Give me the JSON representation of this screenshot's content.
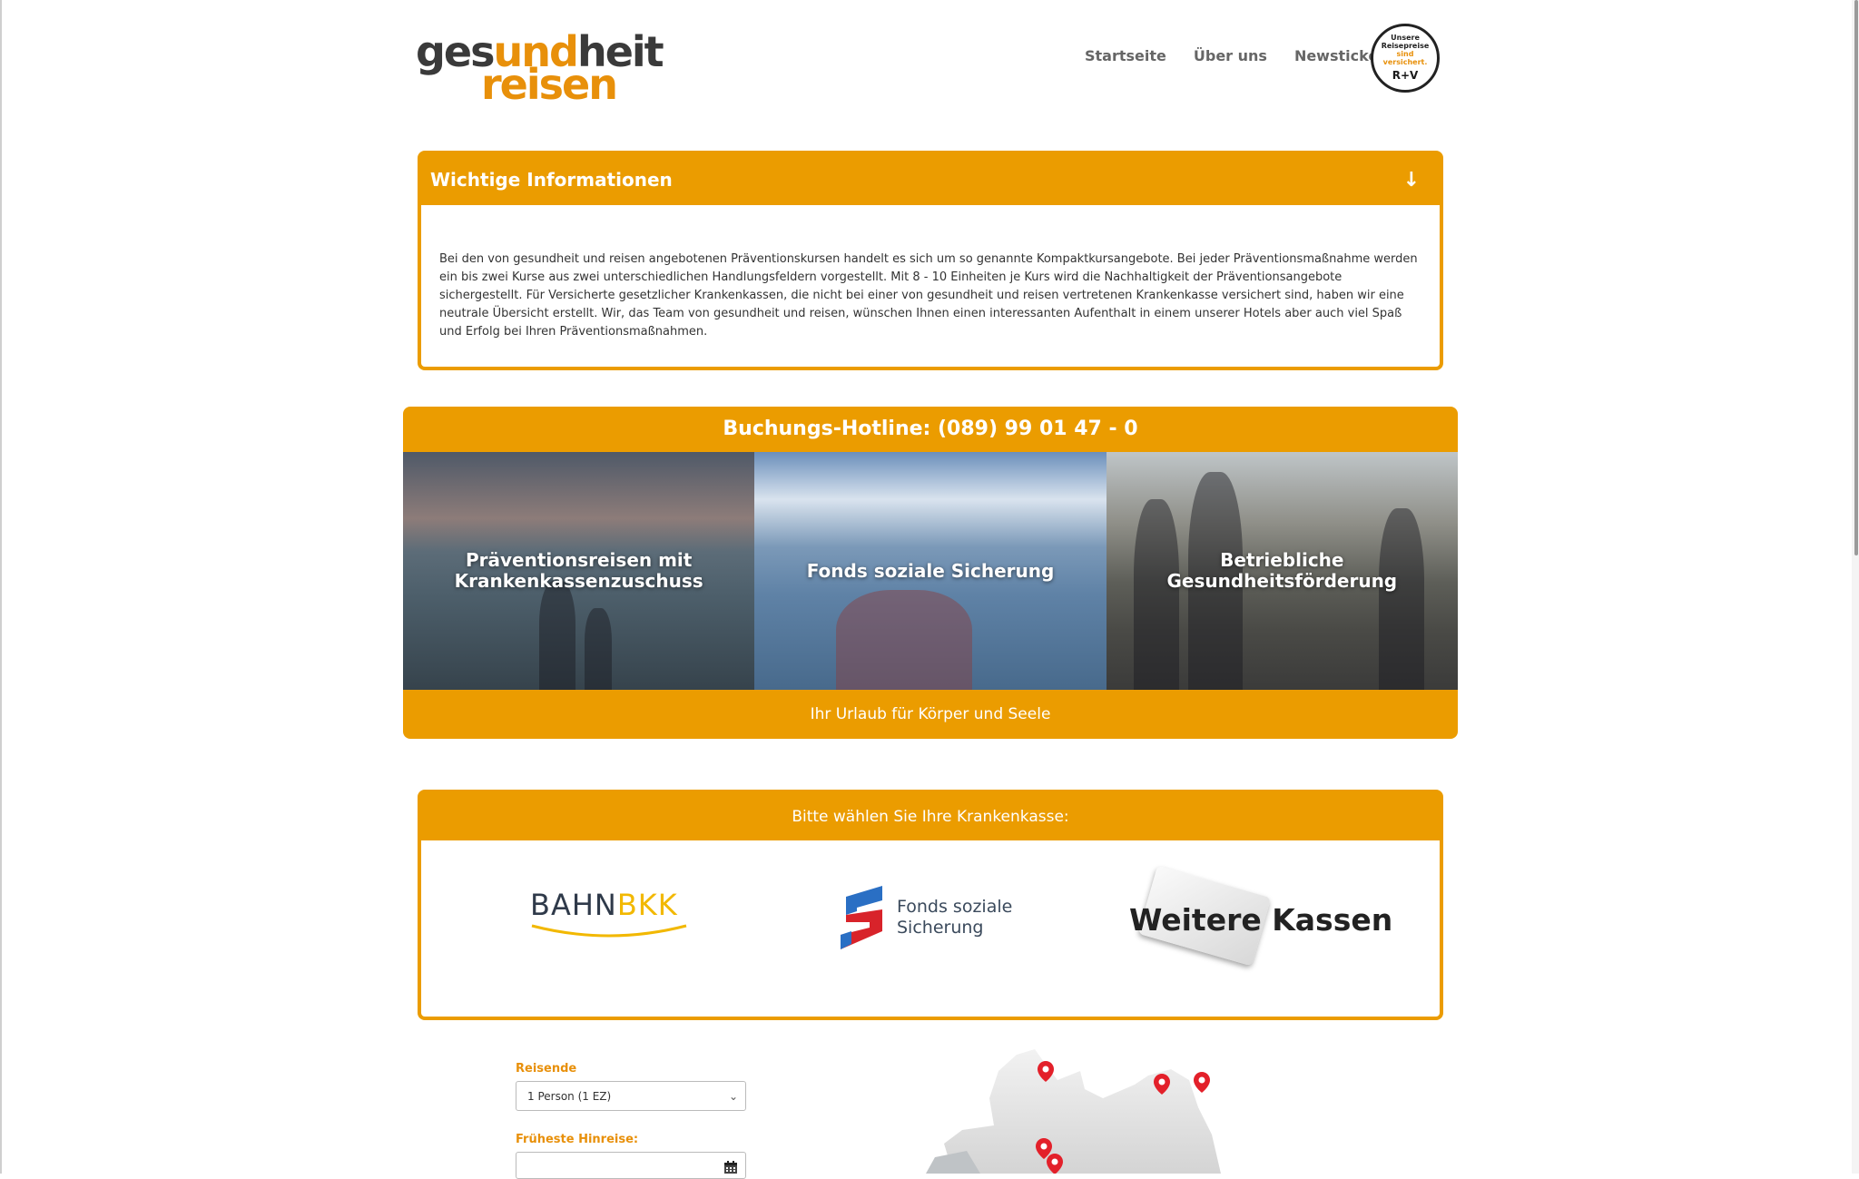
{
  "header": {
    "logo_line1_a": "ges",
    "logo_line1_b": "und",
    "logo_line1_c": "heit",
    "logo_line2": "reisen",
    "nav": [
      "Startseite",
      "Über uns",
      "Newsticker"
    ],
    "seal": {
      "line1": "Unsere",
      "line2": "Reisepreise",
      "line3": "sind versichert.",
      "brand": "R+V"
    }
  },
  "info": {
    "title": "Wichtige Informationen",
    "arrow": "↓",
    "text": "Bei den von gesundheit und reisen angebotenen Präventionskursen handelt es sich um so genannte Kompaktkursangebote. Bei jeder Präventionsmaßnahme werden ein bis zwei Kurse aus zwei unterschiedlichen Handlungsfeldern vorgestellt. Mit 8 - 10 Einheiten je Kurs wird die Nachhaltigkeit der Präventionsangebote sichergestellt. Für Versicherte gesetzlicher Krankenkassen, die nicht bei einer von gesundheit und reisen vertretenen Krankenkasse versichert sind, haben wir eine neutrale Übersicht erstellt. Wir, das Team von gesundheit und reisen, wünschen Ihnen einen interessanten Aufenthalt in einem unserer Hotels aber auch viel Spaß und Erfolg bei Ihren Präventionsmaßnahmen."
  },
  "hotline": {
    "text": "Buchungs-Hotline: (089) 99 01 47 - 0",
    "tiles": [
      {
        "line1": "Präventionsreisen mit",
        "line2": "Krankenkassenzuschuss"
      },
      {
        "line1": "Fonds soziale Sicherung",
        "line2": ""
      },
      {
        "line1": "Betriebliche",
        "line2": "Gesundheitsförderung"
      }
    ],
    "tagline": "Ihr Urlaub für Körper und Seele"
  },
  "kasse": {
    "title": "Bitte wählen Sie Ihre Krankenkasse:",
    "bahn": "BAHN",
    "bkk": "BKK",
    "fonds_line1": "Fonds soziale",
    "fonds_line2": "Sicherung",
    "weitere": "Weitere Kassen"
  },
  "form": {
    "reisende_label": "Reisende",
    "reisende_value": "1 Person (1 EZ)",
    "hinreise_label": "Früheste Hinreise:"
  },
  "colors": {
    "accent": "#eb9c00",
    "logo_orange": "#e8900a",
    "map_pin": "#e3202a"
  }
}
